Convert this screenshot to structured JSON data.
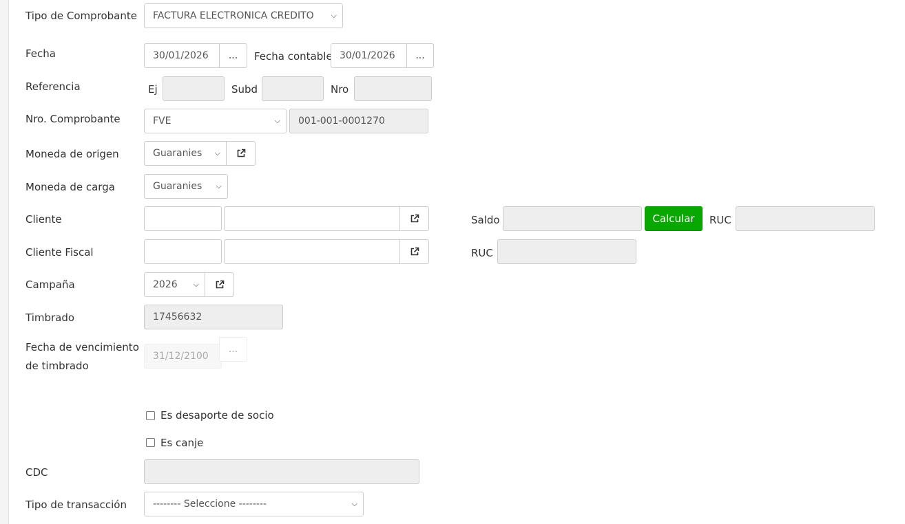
{
  "tipo_comprobante": {
    "label": "Tipo de Comprobante",
    "value": "FACTURA ELECTRONICA CREDITO"
  },
  "fecha": {
    "label": "Fecha",
    "value": "30/01/2026",
    "btn": "..."
  },
  "fecha_contable": {
    "label": "Fecha contable",
    "value": "30/01/2026",
    "btn": "..."
  },
  "referencia": {
    "label": "Referencia",
    "ej_label": "Ej",
    "ej_value": "",
    "subd_label": "Subd",
    "subd_value": "",
    "nro_label": "Nro",
    "nro_value": ""
  },
  "nro_comprobante": {
    "label": "Nro. Comprobante",
    "value": "FVE",
    "numero": "001-001-0001270"
  },
  "moneda_origen": {
    "label": "Moneda de origen",
    "value": "Guaranies",
    "icon": "external-link-icon"
  },
  "moneda_carga": {
    "label": "Moneda de carga",
    "value": "Guaranies"
  },
  "cliente": {
    "label": "Cliente",
    "code": "",
    "name": "",
    "icon": "external-link-icon",
    "saldo_label": "Saldo",
    "saldo_value": "",
    "calcular": "Calcular",
    "ruc_label": "RUC",
    "ruc_value": ""
  },
  "cliente_fiscal": {
    "label": "Cliente Fiscal",
    "code": "",
    "name": "",
    "icon": "external-link-icon",
    "ruc_label": "RUC",
    "ruc_value": ""
  },
  "campana": {
    "label": "Campaña",
    "value": "2026",
    "icon": "external-link-icon"
  },
  "timbrado": {
    "label": "Timbrado",
    "value": "17456632"
  },
  "fecha_venc_timbrado": {
    "label_line1": "Fecha de vencimiento",
    "label_line2": "de timbrado",
    "value": "31/12/2100",
    "btn": "..."
  },
  "desaporte": {
    "label": "Es desaporte de socio",
    "checked": false
  },
  "canje": {
    "label": "Es canje",
    "checked": false
  },
  "cdc": {
    "label": "CDC",
    "value": ""
  },
  "tipo_transaccion": {
    "label": "Tipo de transacción",
    "value": "-------- Seleccione --------"
  },
  "colors": {
    "accent_green": "#09a800",
    "readonly_bg": "#eeeeee",
    "border": "#cccccc"
  }
}
